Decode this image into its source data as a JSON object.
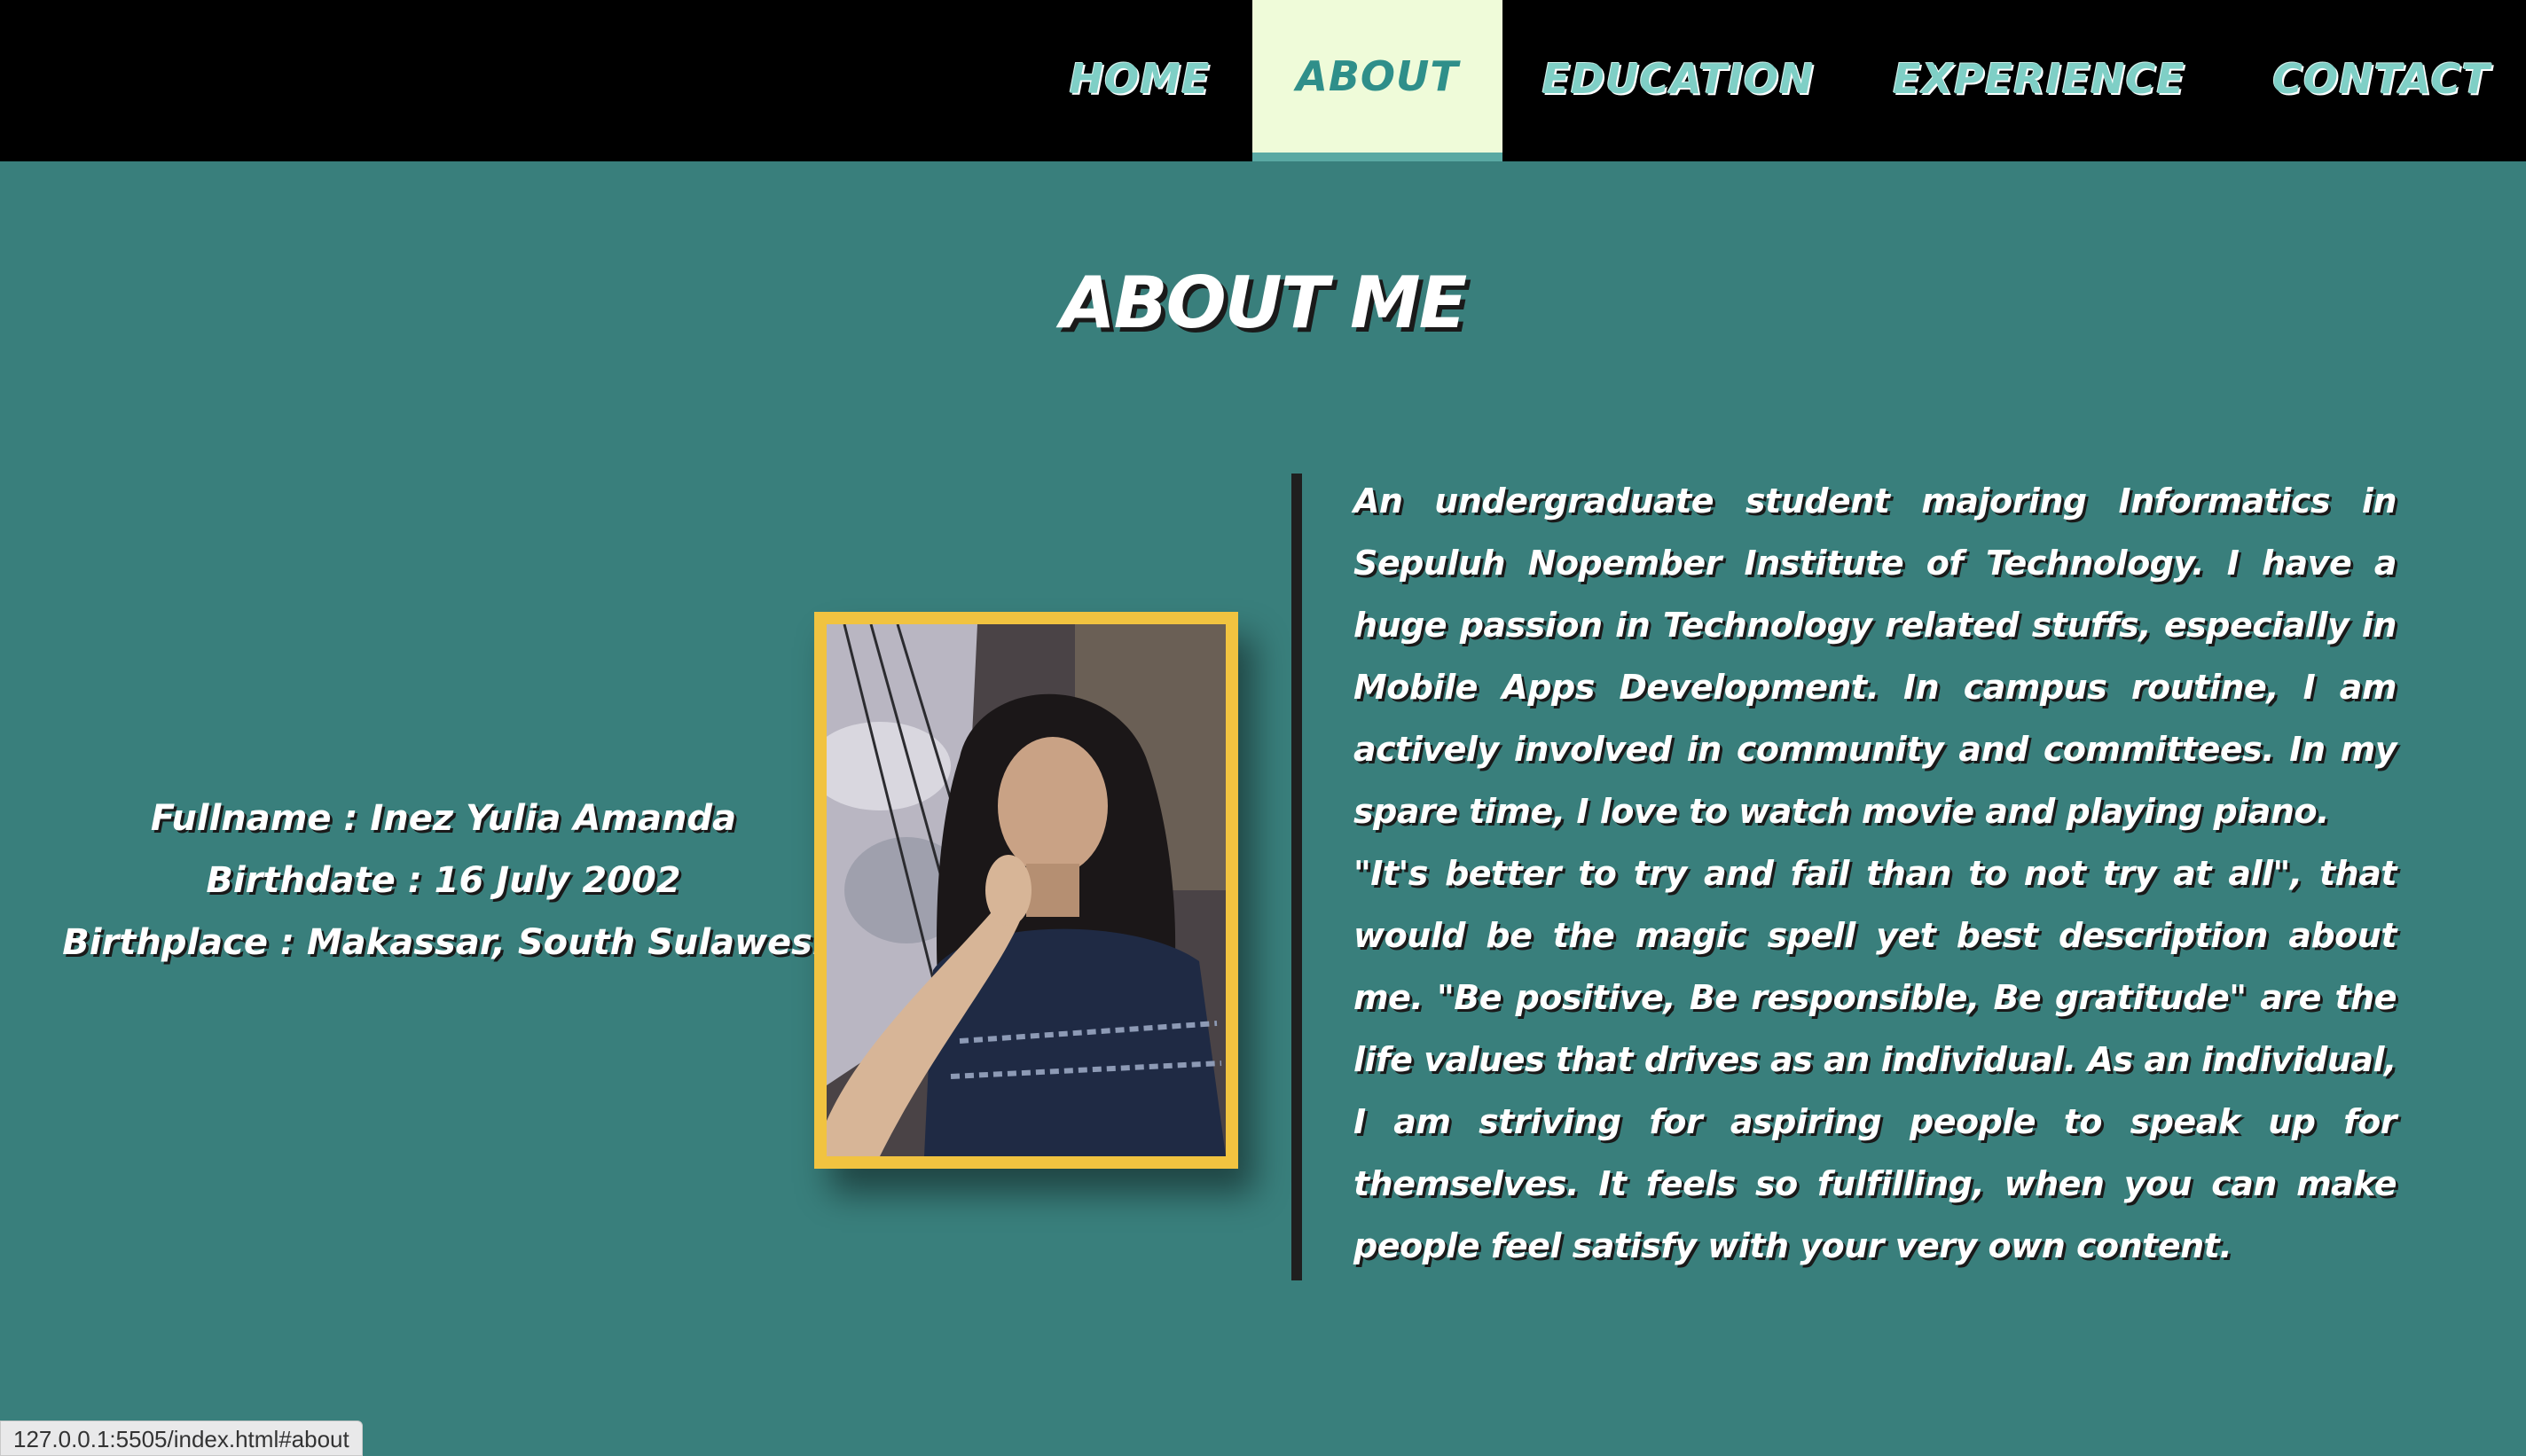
{
  "nav": {
    "items": [
      {
        "label": "HOME",
        "active": false
      },
      {
        "label": "ABOUT",
        "active": true
      },
      {
        "label": "EDUCATION",
        "active": false
      },
      {
        "label": "EXPERIENCE",
        "active": false
      },
      {
        "label": "CONTACT",
        "active": false
      }
    ]
  },
  "about": {
    "title": "ABOUT ME",
    "info": {
      "fullname": "Fullname : Inez Yulia Amanda",
      "birthdate": "Birthdate : 16 July 2002",
      "birthplace": "Birthplace : Makassar, South Sulawesi"
    },
    "bio_paragraph_1": "An undergraduate student majoring Informatics in Sepuluh Nopember Institute of Technology. I have a huge passion in Technology related stuffs, especially in Mobile Apps Development. In campus routine, I am actively involved in community and committees. In my spare time, I love to watch movie and playing piano.",
    "bio_paragraph_2": "\"It's better to try and fail than to not try at all\", that would be the magic spell yet best description about me. \"Be positive, Be responsible, Be gratitude\" are the life values that drives as an individual. As an individual, I am striving for aspiring people to speak up for themselves. It feels so fulfilling, when you can make people feel satisfy with your very own content."
  },
  "colors": {
    "background": "#397f7c",
    "nav_background": "#000000",
    "nav_active": "#effbd9",
    "frame": "#f1c340"
  },
  "status_url": "127.0.0.1:5505/index.html#about"
}
